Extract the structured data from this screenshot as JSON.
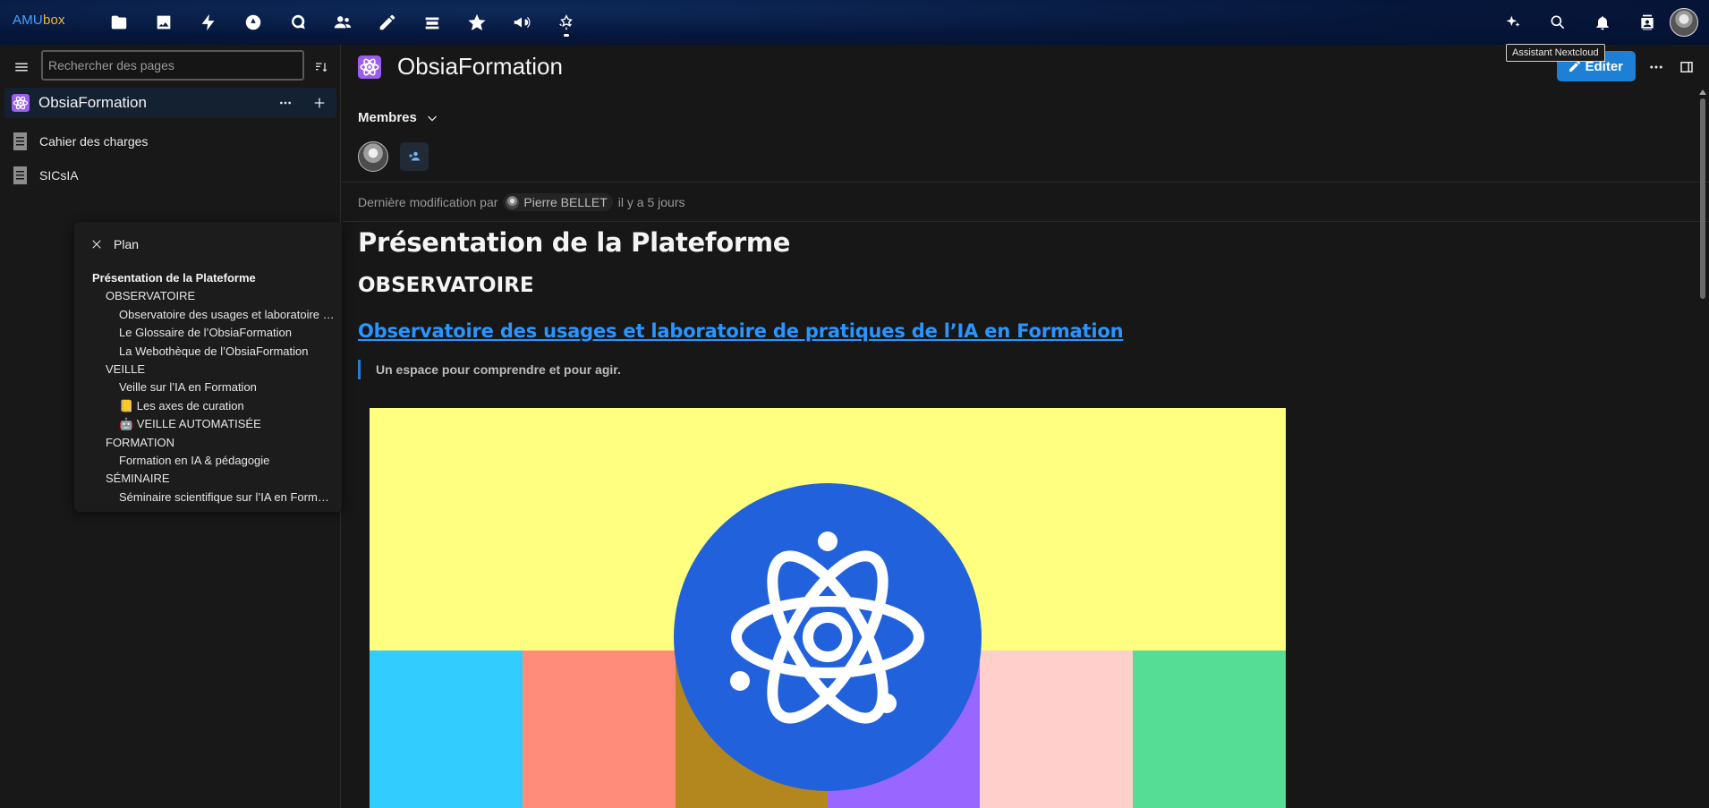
{
  "topbar": {
    "logo_main": "AMU",
    "logo_accent": "box",
    "apps": [
      {
        "icon": "files-icon"
      },
      {
        "icon": "photos-icon"
      },
      {
        "icon": "activity-icon"
      },
      {
        "icon": "dashboard-icon"
      },
      {
        "icon": "talk-icon"
      },
      {
        "icon": "contacts-icon"
      },
      {
        "icon": "notes-icon"
      },
      {
        "icon": "deck-icon"
      },
      {
        "icon": "star-icon"
      },
      {
        "icon": "announcements-icon"
      },
      {
        "icon": "collectives-icon"
      }
    ],
    "right_icons": [
      "assistant-icon",
      "search-icon",
      "notifications-icon",
      "contacts-menu-icon",
      "user-avatar"
    ],
    "tooltip": "Assistant Nextcloud"
  },
  "sidebar": {
    "search_placeholder": "Rechercher des pages",
    "collective": {
      "name": "ObsiaFormation"
    },
    "pages": [
      {
        "label": "Cahier des charges"
      },
      {
        "label": "SICsIA"
      }
    ]
  },
  "toc": {
    "title": "Plan",
    "items": [
      {
        "label": "Présentation de la Plateforme",
        "level": 1
      },
      {
        "label": "OBSERVATOIRE",
        "level": 2
      },
      {
        "label": "Observatoire des usages et laboratoire de pratiques de l’IA en Formation",
        "level": 3
      },
      {
        "label": "Le Glossaire de l’ObsiaFormation",
        "level": 3
      },
      {
        "label": "La Webothèque de l’ObsiaFormation",
        "level": 3
      },
      {
        "label": "VEILLE",
        "level": 2
      },
      {
        "label": "Veille sur l’IA en Formation",
        "level": 3
      },
      {
        "label": "📒 Les axes de curation",
        "level": 3
      },
      {
        "label": "🤖 VEILLE AUTOMATISÉE",
        "level": 3
      },
      {
        "label": "FORMATION",
        "level": 2
      },
      {
        "label": "Formation en IA & pédagogie",
        "level": 3
      },
      {
        "label": "SÉMINAIRE",
        "level": 2
      },
      {
        "label": "Séminaire scientifique sur l’IA en Formation",
        "level": 3
      }
    ]
  },
  "main": {
    "title": "ObsiaFormation",
    "edit_label": "Éditer",
    "members_label": "Membres",
    "last_modified_prefix": "Dernière modification par",
    "last_modified_user": "Pierre BELLET",
    "last_modified_when": "il y a 5 jours",
    "h1": "Présentation de la Plateforme",
    "h2": "OBSERVATOIRE",
    "h3_link": "Observatoire des usages et laboratoire de pratiques de l’IA en Formation",
    "quote": "Un espace pour comprendre et pour agir."
  },
  "colors": {
    "accent": "#1d7fd6",
    "link": "#2a95ff",
    "hero_yellow": "#ffff80",
    "hero_blue_circle": "#2162dc",
    "stripes": [
      "#33ccff",
      "#ff8c7a",
      "#b3861e",
      "#9966ff",
      "#ffcfcc",
      "#55dd95"
    ]
  }
}
